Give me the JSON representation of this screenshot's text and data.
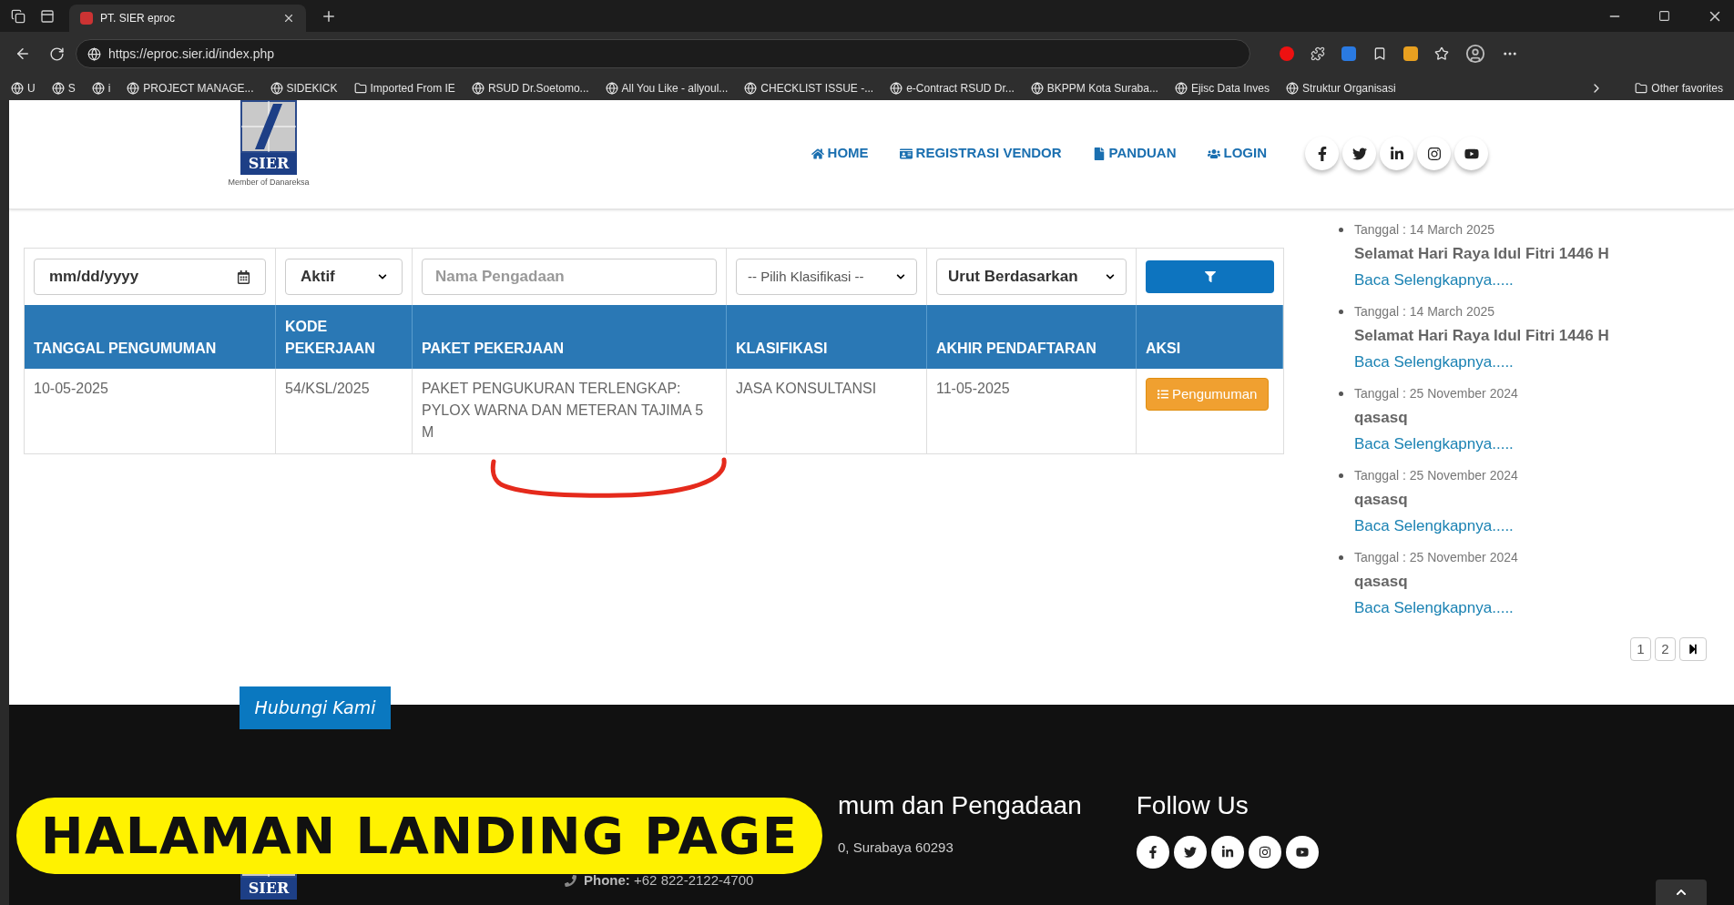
{
  "browser": {
    "tab_title": "PT. SIER eproc",
    "url": "https://eproc.sier.id/index.php",
    "bookmarks": [
      {
        "label": "U",
        "kind": "site"
      },
      {
        "label": "S",
        "kind": "site"
      },
      {
        "label": "i",
        "kind": "site"
      },
      {
        "label": "PROJECT MANAGE...",
        "kind": "site"
      },
      {
        "label": "SIDEKICK",
        "kind": "site"
      },
      {
        "label": "Imported From IE",
        "kind": "folder"
      },
      {
        "label": "RSUD Dr.Soetomo...",
        "kind": "site"
      },
      {
        "label": "All You Like - allyoul...",
        "kind": "site"
      },
      {
        "label": "CHECKLIST ISSUE -...",
        "kind": "site"
      },
      {
        "label": "e-Contract RSUD Dr...",
        "kind": "site"
      },
      {
        "label": "BKPPM Kota Suraba...",
        "kind": "site"
      },
      {
        "label": "Ejisc Data Inves",
        "kind": "site"
      },
      {
        "label": "Struktur Organisasi",
        "kind": "site"
      }
    ],
    "other_favorites": "Other favorites"
  },
  "header": {
    "logo_text": "SIER",
    "logo_subtitle": "Member of Danareksa",
    "nav": [
      {
        "label": "HOME",
        "kind": "home"
      },
      {
        "label": "REGISTRASI VENDOR",
        "kind": "vendor"
      },
      {
        "label": "PANDUAN",
        "kind": "guide"
      },
      {
        "label": "LOGIN",
        "kind": "login"
      }
    ]
  },
  "filters": {
    "date": "mm/dd/yyyy",
    "status": "Aktif",
    "name_placeholder": "Nama Pengadaan",
    "klasifikasi": "-- Pilih Klasifikasi --",
    "sort": "Urut Berdasarkan"
  },
  "table": {
    "columns": [
      "TANGGAL PENGUMUMAN",
      "KODE PEKERJAAN",
      "PAKET PEKERJAAN",
      "KLASIFIKASI",
      "AKHIR PENDAFTARAN",
      "AKSI"
    ],
    "rows": [
      {
        "tanggal": "10-05-2025",
        "kode": "54/KSL/2025",
        "paket": "PAKET PENGUKURAN TERLENGKAP: PYLOX WARNA DAN METERAN TAJIMA 5 M",
        "klasifikasi": "JASA KONSULTANSI",
        "akhir": "11-05-2025",
        "action": "Pengumuman"
      }
    ]
  },
  "news": {
    "items": [
      {
        "date": "Tanggal : 14 March 2025",
        "title": "Selamat Hari Raya Idul Fitri 1446 H",
        "link": "Baca Selengkapnya....."
      },
      {
        "date": "Tanggal : 14 March 2025",
        "title": "Selamat Hari Raya Idul Fitri 1446 H",
        "link": "Baca Selengkapnya....."
      },
      {
        "date": "Tanggal : 25 November 2024",
        "title": "qasasq",
        "link": "Baca Selengkapnya....."
      },
      {
        "date": "Tanggal : 25 November 2024",
        "title": "qasasq",
        "link": "Baca Selengkapnya....."
      },
      {
        "date": "Tanggal : 25 November 2024",
        "title": "qasasq",
        "link": "Baca Selengkapnya....."
      }
    ],
    "pages": [
      "1",
      "2"
    ]
  },
  "footer": {
    "tab": "Hubungi Kami",
    "logo_text": "SIER",
    "heading": "mum dan Pengadaan",
    "address": "0, Surabaya 60293",
    "phone_label": "Phone:",
    "phone": "+62 822-2122-4700",
    "follow_title": "Follow Us"
  },
  "caption": "HALAMAN LANDING PAGE"
}
